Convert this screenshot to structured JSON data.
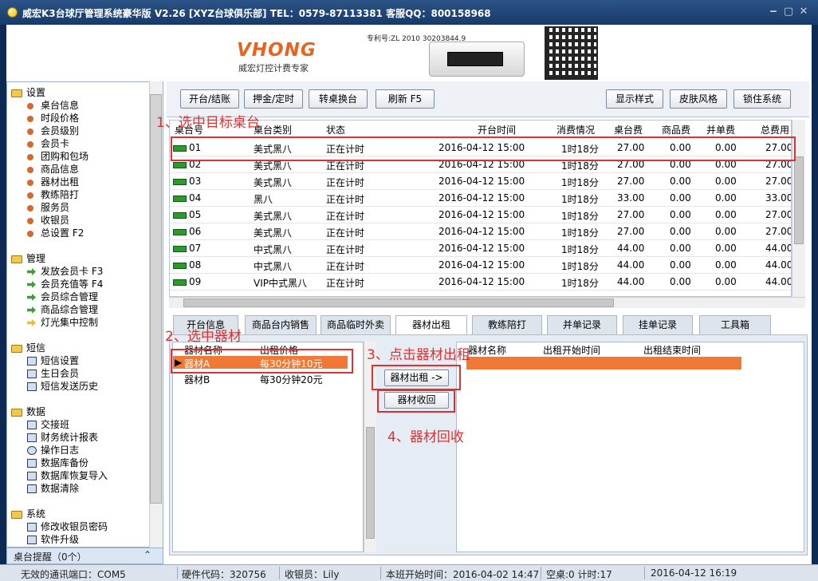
{
  "window": {
    "title": "威宏K3台球厅管理系统豪华版 V2.26   [XYZ台球俱乐部]   TEL：0579-87113381  客服QQ：800158968",
    "controls": [
      "‒",
      "▢",
      "✕"
    ]
  },
  "banner": {
    "logo": "VHONG",
    "logo_sub": "威宏灯控计费专家",
    "patent": "专利号:ZL 2010 30203844.9"
  },
  "sidebar": {
    "groups": [
      {
        "label": "设置",
        "items": [
          "桌台信息",
          "时段价格",
          "会员级别",
          "会员卡",
          "团购和包场",
          "商品信息",
          "器材出租",
          "教练陪打",
          "服务员",
          "收银员",
          "总设置 F2"
        ]
      },
      {
        "label": "管理",
        "items": [
          "发放会员卡 F3",
          "会员充值等 F4",
          "会员综合管理",
          "商品综合管理",
          "灯光集中控制"
        ]
      },
      {
        "label": "短信",
        "items": [
          "短信设置",
          "生日会员",
          "短信发送历史"
        ]
      },
      {
        "label": "数据",
        "items": [
          "交接班",
          "财务统计报表",
          "操作日志",
          "数据库备份",
          "数据库恢复导入",
          "数据清除"
        ]
      },
      {
        "label": "系统",
        "items": [
          "修改收银员密码",
          "软件升级"
        ]
      }
    ],
    "bottom": "桌台提醒（0个）"
  },
  "toolbar": {
    "left": [
      "开台/结账",
      "押金/定时",
      "转桌换台",
      "刷新 F5"
    ],
    "right": [
      "显示样式",
      "皮肤风格",
      "锁住系统"
    ]
  },
  "table": {
    "columns": [
      "桌台号",
      "桌台类别",
      "状态",
      "开台时间",
      "消费情况",
      "桌台费",
      "商品费",
      "并单费",
      "总费用"
    ],
    "rows": [
      [
        "01",
        "美式黑八",
        "正在计时",
        "2016-04-12 15:00",
        "1时18分",
        "27.00",
        "0.00",
        "0.00",
        "27.00"
      ],
      [
        "02",
        "美式黑八",
        "正在计时",
        "2016-04-12 15:00",
        "1时18分",
        "27.00",
        "0.00",
        "0.00",
        "27.00"
      ],
      [
        "03",
        "美式黑八",
        "正在计时",
        "2016-04-12 15:00",
        "1时18分",
        "27.00",
        "0.00",
        "0.00",
        "27.00"
      ],
      [
        "04",
        "黑八",
        "正在计时",
        "2016-04-12 15:00",
        "1时18分",
        "33.00",
        "0.00",
        "0.00",
        "33.00"
      ],
      [
        "05",
        "美式黑八",
        "正在计时",
        "2016-04-12 15:00",
        "1时18分",
        "27.00",
        "0.00",
        "0.00",
        "27.00"
      ],
      [
        "06",
        "美式黑八",
        "正在计时",
        "2016-04-12 15:00",
        "1时18分",
        "27.00",
        "0.00",
        "0.00",
        "27.00"
      ],
      [
        "07",
        "中式黑八",
        "正在计时",
        "2016-04-12 15:00",
        "1时18分",
        "44.00",
        "0.00",
        "0.00",
        "44.00"
      ],
      [
        "08",
        "中式黑八",
        "正在计时",
        "2016-04-12 15:00",
        "1时18分",
        "44.00",
        "0.00",
        "0.00",
        "44.00"
      ],
      [
        "09",
        "VIP中式黑八",
        "正在计时",
        "2016-04-12 15:00",
        "1时18分",
        "44.00",
        "0.00",
        "0.00",
        "44.00"
      ]
    ]
  },
  "tabs": [
    "开台信息",
    "商品台内销售",
    "商品临时外卖",
    "器材出租",
    "教练陪打",
    "并单记录",
    "挂单记录",
    "工具箱"
  ],
  "rental": {
    "left_columns": [
      "器材名称",
      "出租价格"
    ],
    "left_rows": [
      [
        "器材A",
        "每30分钟10元"
      ],
      [
        "器材B",
        "每30分钟20元"
      ]
    ],
    "rent_button": "器材出租 ->",
    "return_button": "器材收回",
    "right_columns": [
      "器材名称",
      "出租开始时间",
      "出租结束时间"
    ]
  },
  "annotations": [
    "1、选中目标桌台",
    "2、选中器材",
    "3、点击器材出租",
    "4、器材回收"
  ],
  "status": {
    "port": "无效的通讯端口：COM5",
    "hardware": "硬件代码：320756",
    "cashier": "收银员：Lily",
    "shift_start": "本班开始时间：2016-04-02 14:47",
    "tables": "空桌:0 计时:17",
    "date": "2016-04-12 16:19"
  },
  "colors": {
    "accent": "#e8641e",
    "annotation": "#e03030",
    "title_bg": "#173a6a",
    "selected_row": "#f07a35"
  }
}
